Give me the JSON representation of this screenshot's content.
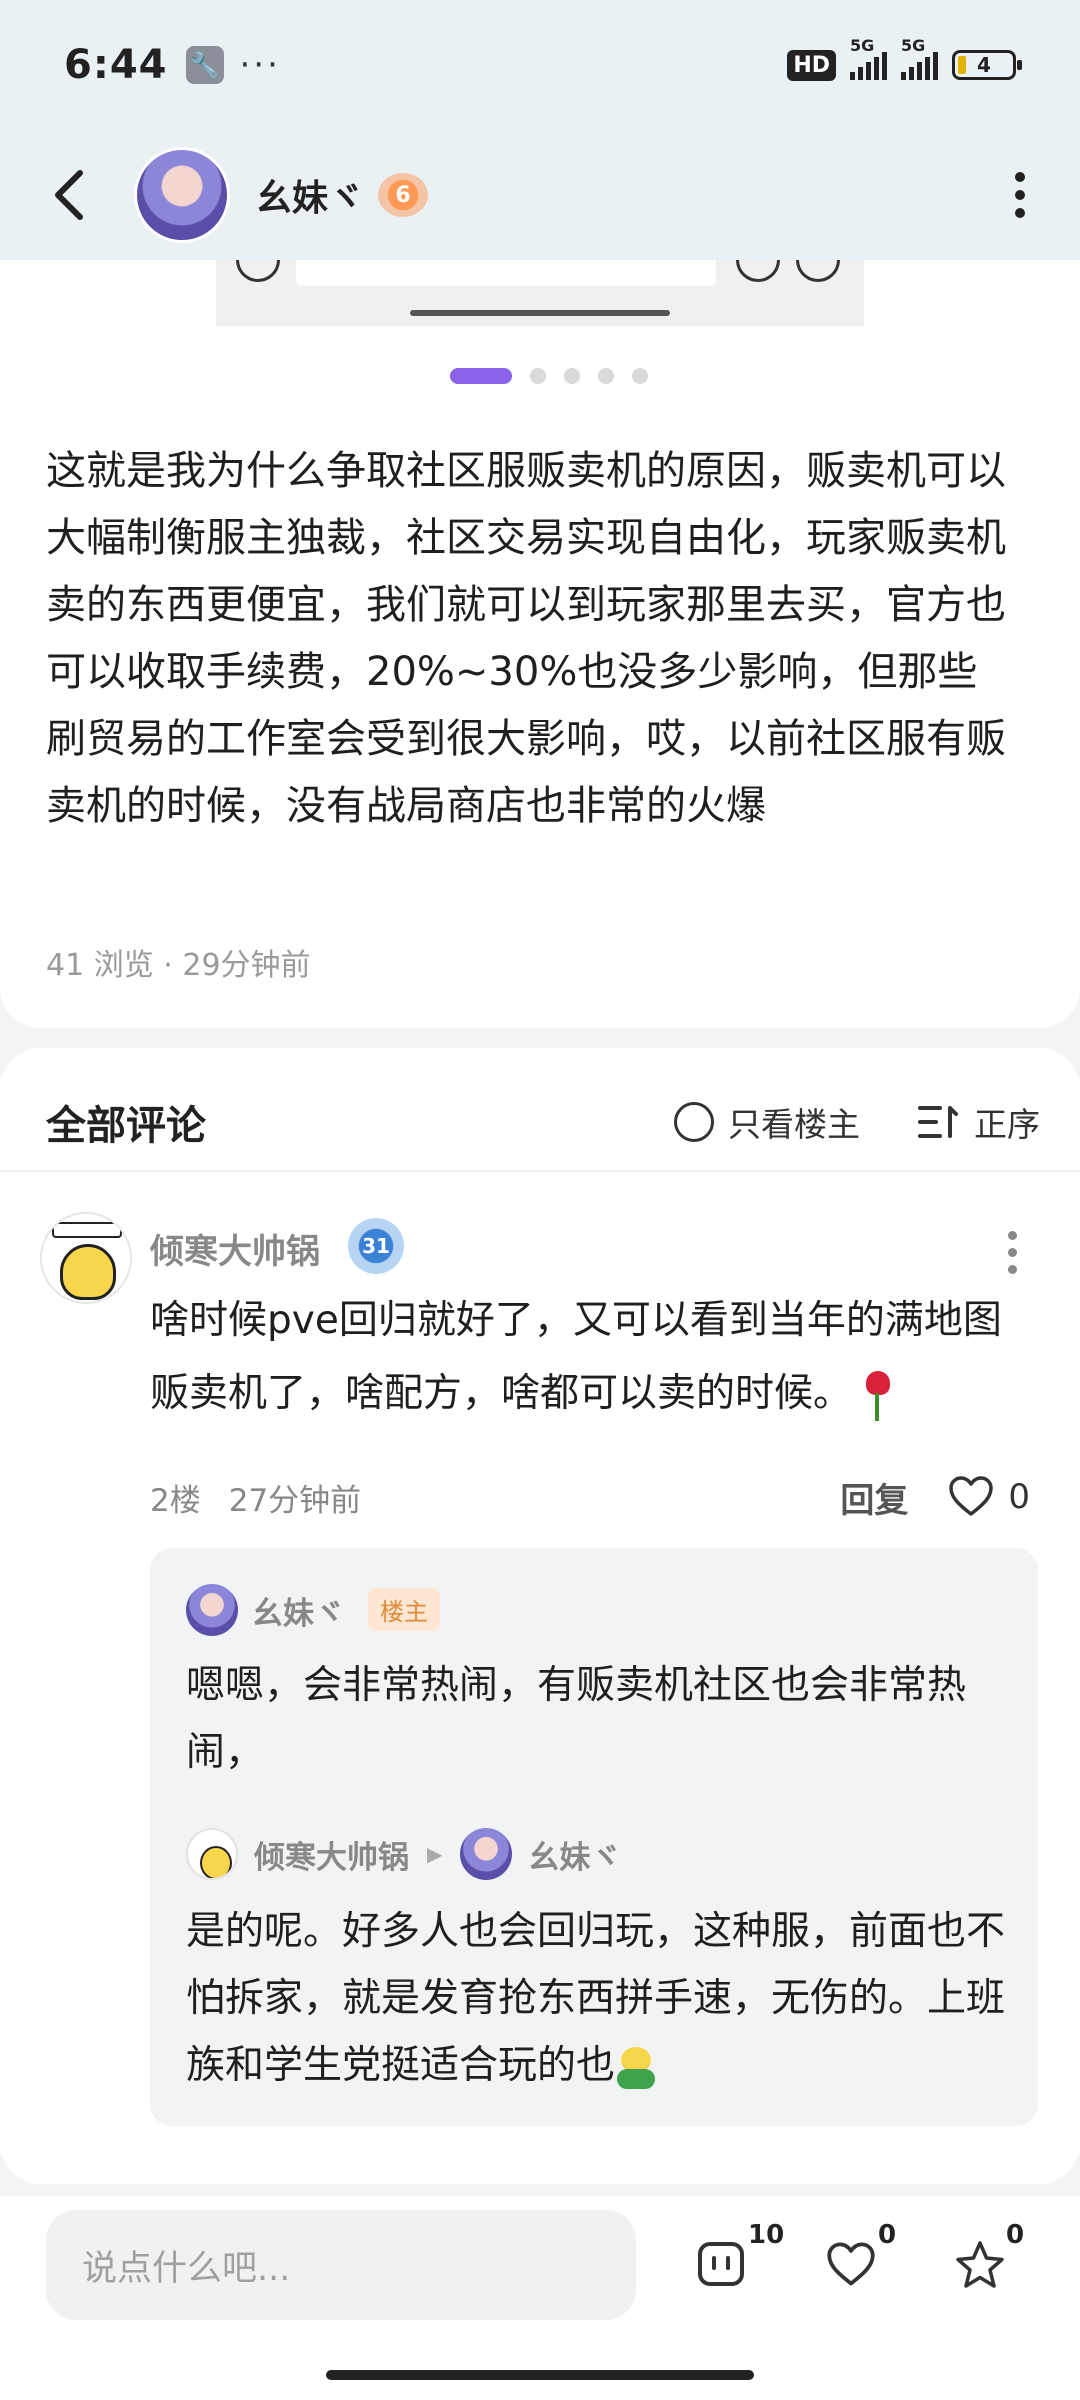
{
  "status_bar": {
    "time": "6:44",
    "hd_label": "HD",
    "net1": "5G",
    "net2": "5G",
    "battery": "4",
    "icons": [
      "wrench-icon",
      "more-dots-icon",
      "hd-icon",
      "signal-icon",
      "battery-icon"
    ]
  },
  "header": {
    "author_name": "幺妹ヾ",
    "level": "6",
    "icons": [
      "back-arrow-icon",
      "more-vertical-icon"
    ]
  },
  "post": {
    "carousel": {
      "pages": 5,
      "active_index": 0
    },
    "body": "这就是我为什么争取社区服贩卖机的原因，贩卖机可以大幅制衡服主独裁，社区交易实现自由化，玩家贩卖机卖的东西更便宜，我们就可以到玩家那里去买，官方也可以收取手续费，20%~30%也没多少影响，但那些刷贸易的工作室会受到很大影响，哎，以前社区服有贩卖机的时候，没有战局商店也非常的火爆",
    "views": "41 浏览",
    "separator": "·",
    "time": "29分钟前"
  },
  "comments": {
    "title": "全部评论",
    "only_owner_label": "只看楼主",
    "sort_label": "正序",
    "items": [
      {
        "author": "倾寒大帅锅",
        "medal": "31",
        "text": "啥时候pve回归就好了，又可以看到当年的满地图贩卖机了，啥配方，啥都可以卖的时候。",
        "floor": "2楼",
        "time": "27分钟前",
        "reply_label": "回复",
        "likes": "0",
        "replies": [
          {
            "author": "幺妹ヾ",
            "tag": "楼主",
            "text": "嗯嗯，会非常热闹，有贩卖机社区也会非常热闹，"
          },
          {
            "author": "倾寒大帅锅",
            "reply_to": "幺妹ヾ",
            "text": "是的呢。好多人也会回归玩，这种服，前面也不怕拆家，就是发育抢东西拼手速，无伤的。上班族和学生党挺适合玩的也"
          }
        ]
      }
    ]
  },
  "bottom_bar": {
    "input_placeholder": "说点什么吧...",
    "comment_count": "10",
    "like_count": "0",
    "favorite_count": "0"
  }
}
